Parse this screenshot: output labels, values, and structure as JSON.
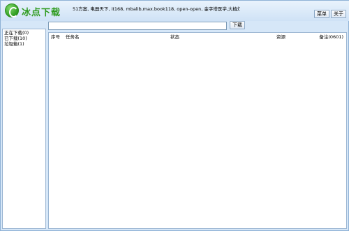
{
  "app": {
    "name": "冰点下载"
  },
  "header": {
    "sites_text": "51方案, 电器天下, it168, mbalib,max.book118, open-open, 金字塔医学,大植灯,金",
    "menu_label": "菜单",
    "about_label": "关于"
  },
  "toolbar": {
    "url_value": "",
    "download_label": "下载"
  },
  "sidebar": {
    "items": [
      {
        "label": "正在下载(0)"
      },
      {
        "label": "已下载(10)"
      },
      {
        "label": "垃圾箱(1)"
      }
    ]
  },
  "list": {
    "columns": [
      "序号",
      "任务名",
      "状态",
      "资源",
      "备注(0601)"
    ]
  }
}
